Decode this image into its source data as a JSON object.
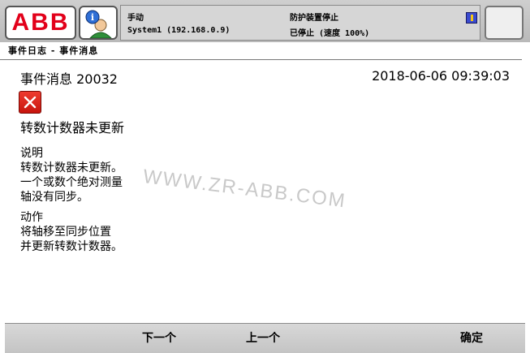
{
  "header": {
    "logo_text": "ABB",
    "mode": "手动",
    "system": "System1 (192.168.0.9)",
    "safety_status": "防护装置停止",
    "run_status": "已停止 (速度 100%)"
  },
  "window": {
    "title": "事件日志 - 事件消息"
  },
  "event": {
    "heading": "事件消息 20032",
    "timestamp": "2018-06-06 09:39:03",
    "title": "转数计数器未更新",
    "description_label": "说明",
    "description_lines": [
      "转数计数器未更新。",
      "一个或数个绝对测量",
      "轴没有同步。"
    ],
    "action_label": "动作",
    "action_lines": [
      "将轴移至同步位置",
      "并更新转数计数器。"
    ]
  },
  "watermark": "WWW.ZR-ABB.COM",
  "footer": {
    "next_label": "下一个",
    "prev_label": "上一个",
    "ok_label": "确定"
  },
  "colors": {
    "error_red": "#d7261a",
    "abb_red": "#e2001a",
    "watermark_gray": "#c9c9c9"
  }
}
